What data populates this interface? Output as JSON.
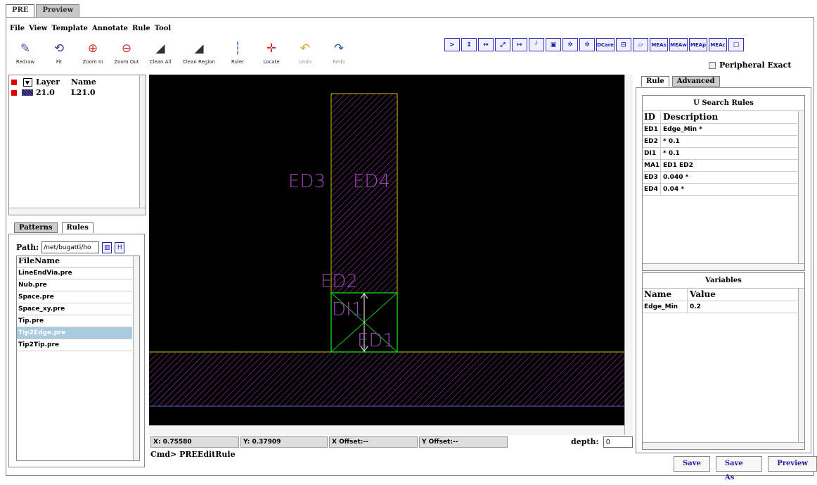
{
  "top_tabs": [
    "PRE",
    "Preview"
  ],
  "menu": [
    "File",
    "View",
    "Template",
    "Annotate",
    "Rule",
    "Tool"
  ],
  "toolbar": [
    {
      "label": "Redraw",
      "icon": "redraw-icon",
      "glyph": "✎"
    },
    {
      "label": "Fit",
      "icon": "fit-icon",
      "glyph": "⟲"
    },
    {
      "label": "Zoom In",
      "icon": "zoom-in-icon",
      "glyph": "⊕"
    },
    {
      "label": "Zoom Out",
      "icon": "zoom-out-icon",
      "glyph": "⊖"
    },
    {
      "label": "Clean All",
      "icon": "eraser-icon",
      "glyph": "◢"
    },
    {
      "label": "Clean Region",
      "icon": "eraser-region-icon",
      "glyph": "◢"
    },
    {
      "label": "Ruler",
      "icon": "ruler-icon",
      "glyph": "┆"
    },
    {
      "label": "Locate",
      "icon": "crosshair-icon",
      "glyph": "✛"
    },
    {
      "label": "Undo",
      "icon": "undo-icon",
      "glyph": "↶"
    },
    {
      "label": "Redo",
      "icon": "redo-icon",
      "glyph": "↷"
    }
  ],
  "right_buttons": [
    ">",
    "↕",
    "↔",
    "⤢",
    "↦",
    "┘",
    "▣",
    "✲",
    "✲",
    "DCare",
    "⊟",
    "▱",
    "MEAs",
    "MEAw",
    "MEAp",
    "MEAc",
    "□"
  ],
  "peripheral_label": "Peripheral Exact",
  "layers": {
    "header": {
      "layer": "Layer",
      "name": "Name"
    },
    "rows": [
      {
        "layer": "21.0",
        "name": "L21.0"
      }
    ]
  },
  "pattern_tabs": [
    "Patterns",
    "Rules"
  ],
  "path": {
    "label": "Path:",
    "value": "/net/bugatti/ho"
  },
  "files": {
    "header": "FileName",
    "rows": [
      "LineEndVia.pre",
      "Nub.pre",
      "Space.pre",
      "Space_xy.pre",
      "Tip.pre",
      "Tip2Edge.pre",
      "Tip2Tip.pre"
    ],
    "selected": "Tip2Edge.pre"
  },
  "canvas_labels": {
    "ed1": "ED1",
    "ed2": "ED2",
    "ed3": "ED3",
    "ed4": "ED4",
    "di1": "DI1"
  },
  "colors": {
    "canvas_bg": "#000000",
    "hatch": "#9a3aa8",
    "edge_yellow": "#d4c000",
    "green_box": "#18c018",
    "label": "#9a48b0"
  },
  "status": {
    "x": "X: 0.75580",
    "y": "Y: 0.37909",
    "x_offset": "X Offset:--",
    "y_offset": "Y Offset:--",
    "depth_label": "depth:",
    "depth_value": "0"
  },
  "cmd": "Cmd> PREEditRule",
  "right_tabs": [
    "Rule",
    "Advanced"
  ],
  "rules": {
    "title": "U Search Rules",
    "header": {
      "id": "ID",
      "desc": "Description"
    },
    "rows": [
      {
        "id": "ED1",
        "desc": "Edge_Min *"
      },
      {
        "id": "ED2",
        "desc": "* 0.1"
      },
      {
        "id": "DI1",
        "desc": "* 0.1"
      },
      {
        "id": "MA1",
        "desc": "ED1 ED2"
      },
      {
        "id": "ED3",
        "desc": "0.040 *"
      },
      {
        "id": "ED4",
        "desc": "0.04 *"
      }
    ]
  },
  "variables": {
    "title": "Variables",
    "header": {
      "name": "Name",
      "value": "Value"
    },
    "rows": [
      {
        "name": "Edge_Min",
        "value": "0.2"
      }
    ]
  },
  "buttons": {
    "save": "Save",
    "save_as": "Save As",
    "preview": "Preview"
  }
}
